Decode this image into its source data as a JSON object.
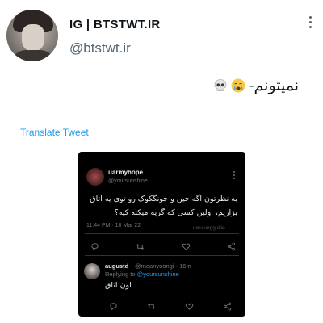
{
  "tweet": {
    "author_name": "IG | BTSTWT.IR",
    "author_handle": "@btstwt.ir",
    "text": "نمیتونم-",
    "emojis": [
      "skull-emoji",
      "loudly-crying-emoji"
    ],
    "translate_label": "Translate Tweet"
  },
  "embedded": {
    "author_name": "uarmyhope",
    "author_handle": "@yoursunshine",
    "text": "به نظرتون اگه جین و جونگکوک رو توی یه اتاق بزاریم، اولین کسی که گریه میکنه کیه؟",
    "timestamp": "11:44 PM · 18 Mar 22",
    "watermark": "uwujunggukie",
    "reply": {
      "author_name": "augustd",
      "handle_time": "@meanyoongi · 16m",
      "replying_prefix": "Replying to",
      "replying_to": "@yoursunshine",
      "text": "اون اتاق"
    }
  },
  "colors": {
    "link": "#1d9bf0",
    "secondary_text": "#536471",
    "card_background": "#000000"
  }
}
